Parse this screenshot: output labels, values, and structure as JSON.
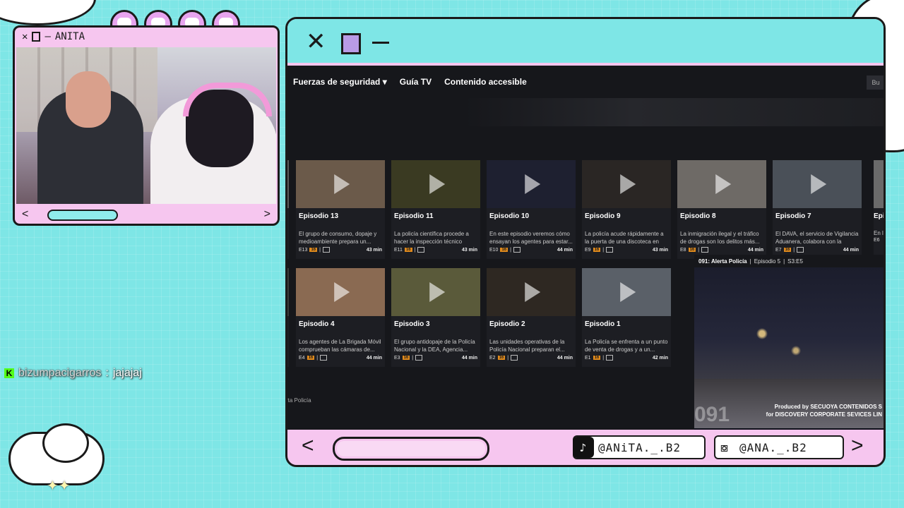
{
  "overlay": {
    "cam_title": "ANITA",
    "cam_nav_prev": "<",
    "cam_nav_next": ">",
    "chat": {
      "badge": "K",
      "user": "bizumpacigarros",
      "separator": ":",
      "message": "jajajaj"
    },
    "social": {
      "tiktok_icon": "tiktok-icon",
      "tiktok_handle": "@ANiTA._.B2",
      "instagram_icon": "instagram-icon",
      "instagram_handle": "@ANA._.B2",
      "prev": "<",
      "next": ">"
    }
  },
  "browser": {
    "nav": [
      "Fuerzas de seguridad ▾",
      "Guía TV",
      "Contenido accesible"
    ],
    "nav_right": "Bu",
    "row1": [
      {
        "title": "Episodio 13",
        "desc": "El grupo de consumo, dopaje y medioambiente prepara un...",
        "code": "E13",
        "rating": "16",
        "duration": "43 min",
        "bg": "#6b5a4a"
      },
      {
        "title": "Episodio 11",
        "desc": "La policía científica procede a hacer la inspección técnico ocul...",
        "code": "E11",
        "rating": "16",
        "duration": "43 min",
        "bg": "#3a3a22"
      },
      {
        "title": "Episodio 10",
        "desc": "En este episodio veremos cómo ensayan los agentes para estar...",
        "code": "E10",
        "rating": "16",
        "duration": "44 min",
        "bg": "#1e2030"
      },
      {
        "title": "Episodio 9",
        "desc": "La policía acude rápidamente a la puerta de una discoteca en Tirso...",
        "code": "E9",
        "rating": "16",
        "duration": "43 min",
        "bg": "#2a2624"
      },
      {
        "title": "Episodio 8",
        "desc": "La inmigración ilegal y el tráfico de drogas son los delitos más...",
        "code": "E8",
        "rating": "16",
        "duration": "44 min",
        "bg": "#6e6a66"
      },
      {
        "title": "Episodio 7",
        "desc": "El DAVA, el servicio de Vigilancia Aduanera, colabora con la Policí...",
        "code": "E7",
        "rating": "16",
        "duration": "44 min",
        "bg": "#4a5058"
      }
    ],
    "row2": [
      {
        "title": "Episodio 4",
        "desc": "Los agentes de La Brigada Móvil comprueban las cámaras de...",
        "code": "E4",
        "rating": "16",
        "duration": "44 min",
        "bg": "#8a6a52"
      },
      {
        "title": "Episodio 3",
        "desc": "El grupo antidopaje de la Policía Nacional y la DEA, Agencia...",
        "code": "E3",
        "rating": "16",
        "duration": "44 min",
        "bg": "#5a5a3a"
      },
      {
        "title": "Episodio 2",
        "desc": "Las unidades operativas de la Policía Nacional preparan el...",
        "code": "E2",
        "rating": "16",
        "duration": "44 min",
        "bg": "#2e2822"
      },
      {
        "title": "Episodio 1",
        "desc": "La Policía se enfrenta a un punto de venta de drogas y a un...",
        "code": "E1",
        "rating": "16",
        "duration": "42 min",
        "bg": "#5a6068"
      }
    ],
    "left_durations": [
      "min",
      "min"
    ],
    "partial_right": {
      "title": "Epis",
      "desc": "En la oper...",
      "code": "E6"
    },
    "preview": {
      "show": "091: Alerta Policía",
      "episode": "Episodio 5",
      "code": "S3:E5",
      "credit1": "Produced by SECUOYA CONTENIDOS S",
      "credit2": "for DISCOVERY CORPORATE SEVICES LIN",
      "logo": "091"
    },
    "footer": "rta Policía"
  }
}
